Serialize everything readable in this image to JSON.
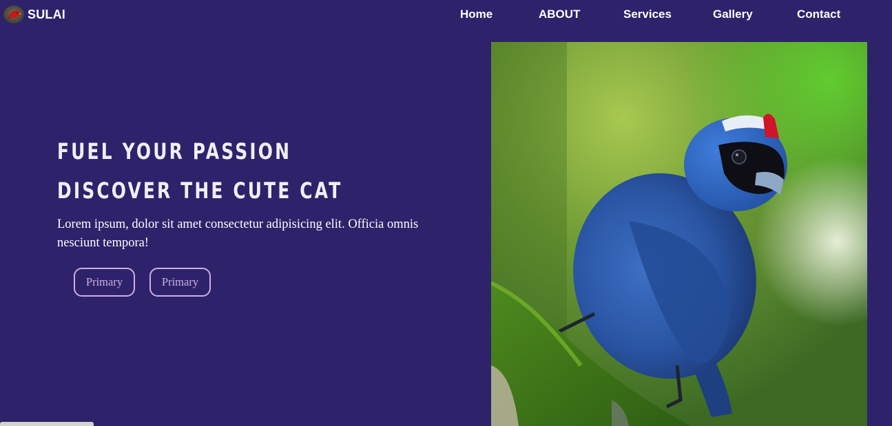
{
  "brand": {
    "name": "SULAI",
    "logo_icon": "bird-logo-icon"
  },
  "nav": {
    "items": [
      {
        "label": "Home"
      },
      {
        "label": "ABOUT"
      },
      {
        "label": "Services"
      },
      {
        "label": "Gallery"
      },
      {
        "label": "Contact"
      }
    ]
  },
  "hero": {
    "title_line1": "FUEL YOUR PASSION",
    "title_line2": "DISCOVER THE CUTE CAT",
    "text": "Lorem ipsum, dolor sit amet consectetur adipisicing elit. Officia omnis nesciunt tempora!",
    "buttons": [
      {
        "label": "Primary"
      },
      {
        "label": "Primary"
      }
    ],
    "image_icon": "blue-bird-photo"
  },
  "colors": {
    "background": "#2e226b",
    "text": "#ffffff",
    "button_outline": "#cdb0df"
  }
}
